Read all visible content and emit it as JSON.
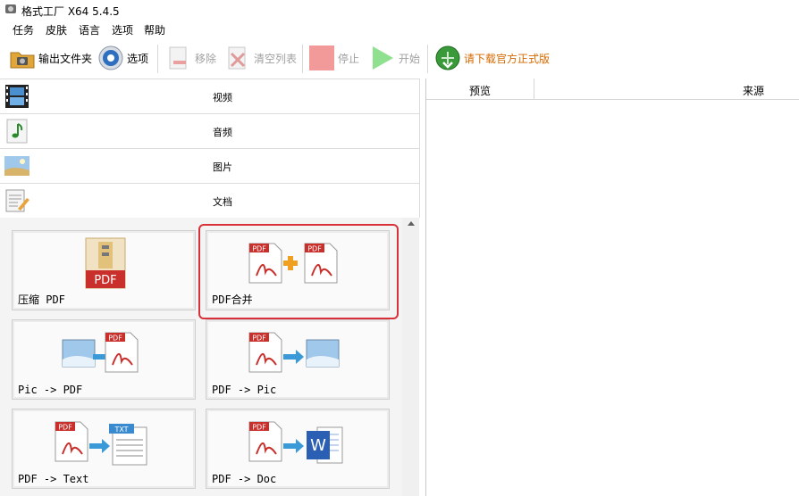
{
  "window": {
    "title": "格式工厂 X64 5.4.5"
  },
  "menu": [
    "任务",
    "皮肤",
    "语言",
    "选项",
    "帮助"
  ],
  "toolbar": {
    "output_folder": "输出文件夹",
    "options": "选项",
    "remove": "移除",
    "clear_list": "清空列表",
    "stop": "停止",
    "start": "开始",
    "download": "请下载官方正式版"
  },
  "categories": [
    "视频",
    "音频",
    "图片",
    "文档"
  ],
  "tiles": [
    {
      "label": "压缩 PDF"
    },
    {
      "label": "PDF合并"
    },
    {
      "label": "Pic -> PDF"
    },
    {
      "label": "PDF -> Pic"
    },
    {
      "label": "PDF -> Text"
    },
    {
      "label": "PDF -> Doc"
    }
  ],
  "icon_text": {
    "pdf": "PDF",
    "txt": "TXT",
    "word": "W"
  },
  "table": {
    "col1": "预览",
    "col2": "来源"
  },
  "colors": {
    "highlight": "#d9313a",
    "download_text": "#d46a00",
    "pdf_red": "#c9302c"
  }
}
